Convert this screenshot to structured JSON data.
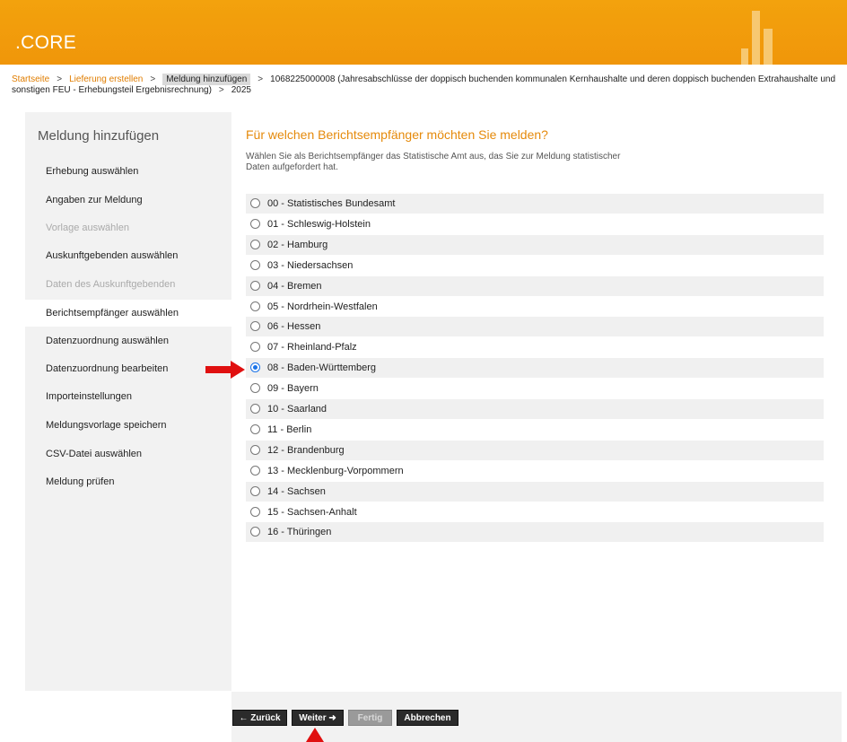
{
  "app": {
    "logo": ".CORE"
  },
  "breadcrumb": {
    "items": [
      "Startseite",
      "Lieferung erstellen",
      "Meldung hinzufügen"
    ],
    "separator": ">",
    "detail": "1068225000008 (Jahresabschlüsse der doppisch buchenden kommunalen Kernhaushalte und deren doppisch buchenden Extrahaushalte und sonstigen FEU - Erhebungsteil Ergebnisrechnung)",
    "year": "2025"
  },
  "sidebar": {
    "title": "Meldung hinzufügen",
    "items": [
      {
        "label": "Erhebung auswählen",
        "state": "normal"
      },
      {
        "label": "Angaben zur Meldung",
        "state": "normal"
      },
      {
        "label": "Vorlage auswählen",
        "state": "disabled"
      },
      {
        "label": "Auskunftgebenden auswählen",
        "state": "normal"
      },
      {
        "label": "Daten des Auskunftgebenden",
        "state": "disabled"
      },
      {
        "label": "Berichtsempfänger auswählen",
        "state": "active"
      },
      {
        "label": "Datenzuordnung auswählen",
        "state": "normal"
      },
      {
        "label": "Datenzuordnung bearbeiten",
        "state": "normal"
      },
      {
        "label": "Importeinstellungen",
        "state": "normal"
      },
      {
        "label": "Meldungsvorlage speichern",
        "state": "normal"
      },
      {
        "label": "CSV-Datei auswählen",
        "state": "normal"
      },
      {
        "label": "Meldung prüfen",
        "state": "normal"
      }
    ]
  },
  "main": {
    "title": "Für welchen Berichtsempfänger möchten Sie melden?",
    "description": "Wählen Sie als Berichtsempfänger das Statistische Amt aus, das Sie zur Meldung statistischer Daten aufgefordert hat.",
    "selected_index": 8,
    "options": [
      "00 - Statistisches Bundesamt",
      "01 - Schleswig-Holstein",
      "02 - Hamburg",
      "03 - Niedersachsen",
      "04 - Bremen",
      "05 - Nordrhein-Westfalen",
      "06 - Hessen",
      "07 - Rheinland-Pfalz",
      "08 - Baden-Württemberg",
      "09 - Bayern",
      "10 - Saarland",
      "11 - Berlin",
      "12 - Brandenburg",
      "13 - Mecklenburg-Vorpommern",
      "14 - Sachsen",
      "15 - Sachsen-Anhalt",
      "16 - Thüringen"
    ]
  },
  "buttons": {
    "back": "← Zurück",
    "next": "Weiter ➜",
    "finish": "Fertig",
    "cancel": "Abbrechen"
  },
  "colors": {
    "header": "#f0960a",
    "accent_text": "#e58a0b",
    "link": "#e07d00",
    "annotation_arrow": "#e01010",
    "radio_selected": "#1a73e8"
  }
}
